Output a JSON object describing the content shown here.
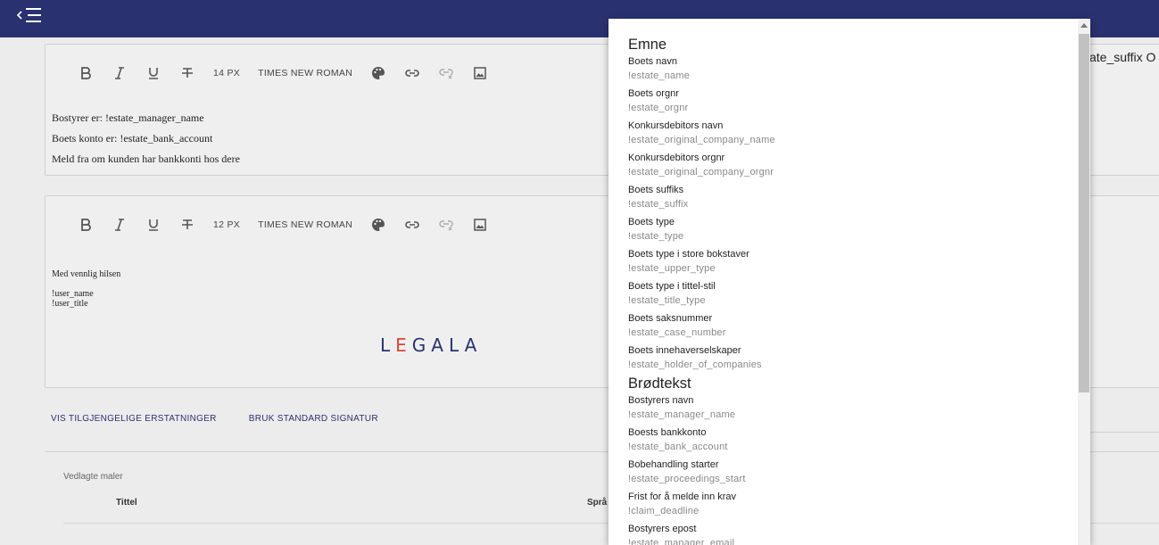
{
  "toolbar1": {
    "font_size": "14 PX",
    "font_family": "TIMES NEW ROMAN"
  },
  "toolbar2": {
    "font_size": "12 PX",
    "font_family": "TIMES NEW ROMAN"
  },
  "editor1": {
    "lines": [
      "Bostyrer er: !estate_manager_name",
      "Boets konto er: !estate_bank_account",
      "Meld fra om kunden har bankkonti hos dere"
    ]
  },
  "editor2": {
    "greeting": "Med vennlig hilsen",
    "user_name": "!user_name",
    "user_title": "!user_title",
    "logo": {
      "l": "L",
      "e": "E",
      "rest": "GALA"
    }
  },
  "actions": {
    "show_replacements": "VIS TILGJENGELIGE ERSTATNINGER",
    "use_signature": "BRUK STANDARD SIGNATUR"
  },
  "templates": {
    "label": "Vedlagte maler",
    "col_title": "Tittel",
    "col_language": "Språ"
  },
  "right_panel": {
    "text": "ate_suffix O"
  },
  "popup": {
    "sections": [
      {
        "heading": "Emne",
        "items": [
          {
            "label": "Boets navn",
            "code": "!estate_name"
          },
          {
            "label": "Boets orgnr",
            "code": "!estate_orgnr"
          },
          {
            "label": "Konkursdebitors navn",
            "code": "!estate_original_company_name"
          },
          {
            "label": "Konkursdebitors orgnr",
            "code": "!estate_original_company_orgnr"
          },
          {
            "label": "Boets suffiks",
            "code": "!estate_suffix"
          },
          {
            "label": "Boets type",
            "code": "!estate_type"
          },
          {
            "label": "Boets type i store bokstaver",
            "code": "!estate_upper_type"
          },
          {
            "label": "Boets type i tittel-stil",
            "code": "!estate_title_type"
          },
          {
            "label": "Boets saksnummer",
            "code": "!estate_case_number"
          },
          {
            "label": "Boets innehaverselskaper",
            "code": "!estate_holder_of_companies"
          }
        ]
      },
      {
        "heading": "Brødtekst",
        "items": [
          {
            "label": "Bostyrers navn",
            "code": "!estate_manager_name"
          },
          {
            "label": "Boests bankkonto",
            "code": "!estate_bank_account"
          },
          {
            "label": "Bobehandling starter",
            "code": "!estate_proceedings_start"
          },
          {
            "label": "Frist for å melde inn krav",
            "code": "!claim_deadline"
          },
          {
            "label": "Bostyrers epost",
            "code": "!estate_manager_email"
          }
        ]
      }
    ]
  },
  "icons": [
    "menu-icon",
    "bold-icon",
    "italic-icon",
    "underline-icon",
    "strikethrough-icon",
    "palette-icon",
    "link-icon",
    "unlink-icon",
    "image-icon"
  ],
  "colors": {
    "topbar": "#2a3170",
    "accent": "#2a3170",
    "logo_e": "#d9463a"
  }
}
